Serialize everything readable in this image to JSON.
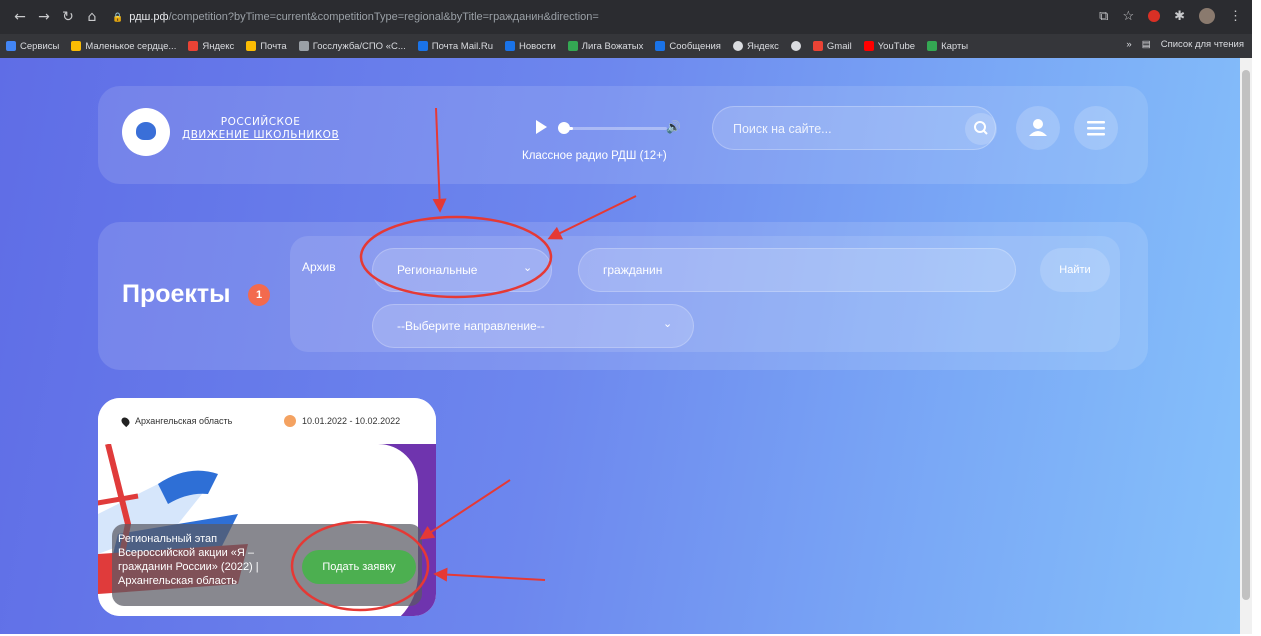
{
  "browser": {
    "url_host": "рдш.рф",
    "url_path": "/competition?byTime=current&competitionType=regional&byTitle=гражданин&direction=",
    "bookmarks": [
      "Сервисы",
      "Маленькое сердце...",
      "Яндекс",
      "Почта",
      "Госслужба/СПО «С...",
      "Почта Mail.Ru",
      "Новости",
      "Лига Вожатых",
      "Сообщения",
      "Яндекс",
      "Gmail",
      "YouTube",
      "Карты"
    ],
    "reading_list": "Список для чтения",
    "more_label": "»"
  },
  "header": {
    "logo_line1": "РОССИЙСКОЕ",
    "logo_line2": "ДВИЖЕНИЕ ШКОЛЬНИКОВ",
    "radio_label": "Классное радио РДШ (12+)",
    "search_placeholder": "Поиск на сайте..."
  },
  "filters": {
    "title": "Проекты",
    "count": "1",
    "archive_label": "Архив",
    "type_selected": "Региональные",
    "query": "гражданин",
    "find_label": "Найти",
    "direction_placeholder": "--Выберите направление--"
  },
  "project": {
    "region": "Архангельская область",
    "dates": "10.01.2022 - 10.02.2022",
    "title": "Региональный этап Всероссийской акции «Я – гражданин России» (2022) | Архангельская область",
    "apply_label": "Подать заявку"
  },
  "colors": {
    "accent_green": "#4caf50",
    "badge": "#f36a4e",
    "annotation_red": "#e53935"
  }
}
